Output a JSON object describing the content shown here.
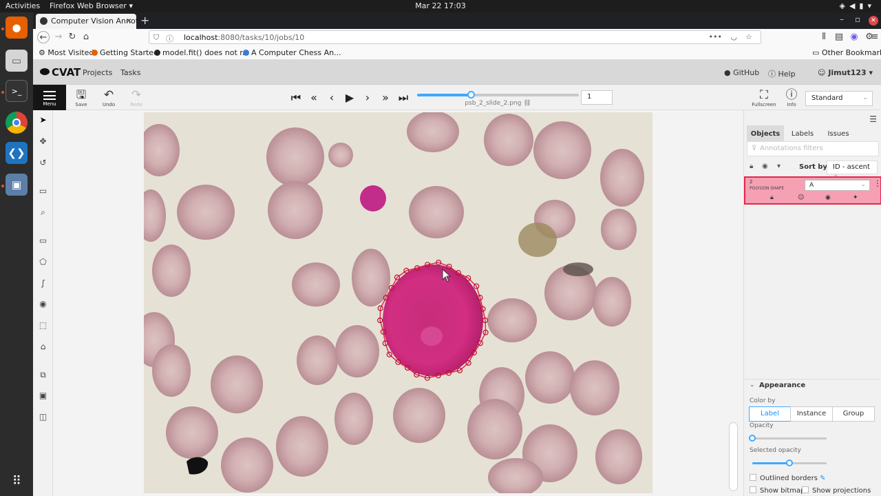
{
  "system": {
    "activities": "Activities",
    "app_name": "Firefox Web Browser ▾",
    "clock": "Mar 22  17:03"
  },
  "browser": {
    "tab_title": "Computer Vision Annota",
    "url_host": "localhost",
    "url_rest": ":8080/tasks/10/jobs/10",
    "bookmarks": [
      "Most Visited",
      "Getting Started",
      "model.fit() does not r...",
      "A Computer Chess An..."
    ],
    "other_bookmarks": "Other Bookmarks"
  },
  "cvat": {
    "logo": "CVAT",
    "nav": [
      "Projects",
      "Tasks"
    ],
    "github": "GitHub",
    "help": "Help",
    "user": "Jimut123"
  },
  "toolbar": {
    "menu": "Menu",
    "save": "Save",
    "undo": "Undo",
    "redo": "Redo",
    "filename": "psb_2_slide_2.png",
    "frame": "1",
    "frame_progress": 0.33,
    "fullscreen": "Fullscreen",
    "info": "Info",
    "workspace": "Standard"
  },
  "sidebar": {
    "tabs": [
      "Objects",
      "Labels",
      "Issues"
    ],
    "filter_placeholder": "Annotations filters",
    "sort_by": "Sort by",
    "sort_value": "ID - ascent",
    "object": {
      "id": "2",
      "type": "POLYGON SHAPE",
      "label": "A",
      "color": "#e2274d"
    },
    "appearance": {
      "title": "Appearance",
      "color_by": "Color by",
      "color_by_options": [
        "Label",
        "Instance",
        "Group"
      ],
      "opacity": "Opacity",
      "opacity_value": 0.0,
      "selected_opacity": "Selected opacity",
      "selected_opacity_value": 0.5,
      "outlined_borders": "Outlined borders",
      "show_bitmap": "Show bitmap",
      "show_projections": "Show projections"
    }
  }
}
